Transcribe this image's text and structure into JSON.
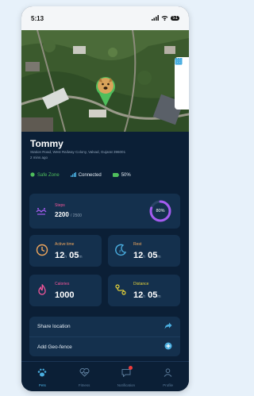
{
  "status_bar": {
    "time": "5:13",
    "battery": "51"
  },
  "pet": {
    "name": "Tommy",
    "address": "Station Road, West Railway Colony, Valsad, Gujarat 396001",
    "updated": "2 mins ago"
  },
  "status": {
    "zone": "Safe Zone",
    "connection": "Connected",
    "battery": "50%"
  },
  "steps": {
    "label": "Steps",
    "value": "2200",
    "goal": "/ 2500",
    "progress": "80%",
    "progress_fraction": 0.8
  },
  "metrics": {
    "active_time": {
      "label": "Active time",
      "hours": "12",
      "h_unit": "h",
      "minutes": "05",
      "m_unit": "m"
    },
    "rest": {
      "label": "Rest",
      "hours": "12",
      "h_unit": "h",
      "minutes": "05",
      "m_unit": "m"
    },
    "calories": {
      "label": "Calories",
      "value": "1000"
    },
    "distance": {
      "label": "Distance",
      "hours": "12",
      "h_unit": "h",
      "minutes": "05",
      "m_unit": "m"
    }
  },
  "actions": {
    "share": "Share location",
    "geofence": "Add Geo-fence"
  },
  "nav": {
    "pets": "Pets",
    "fitness": "Fitness",
    "notification": "Notification",
    "profile": "Profile"
  },
  "colors": {
    "accent": "#4aaee0",
    "orange": "#f0a75d",
    "pink": "#f5569b",
    "purple": "#a45cf0",
    "safe": "#4fbe5c"
  }
}
